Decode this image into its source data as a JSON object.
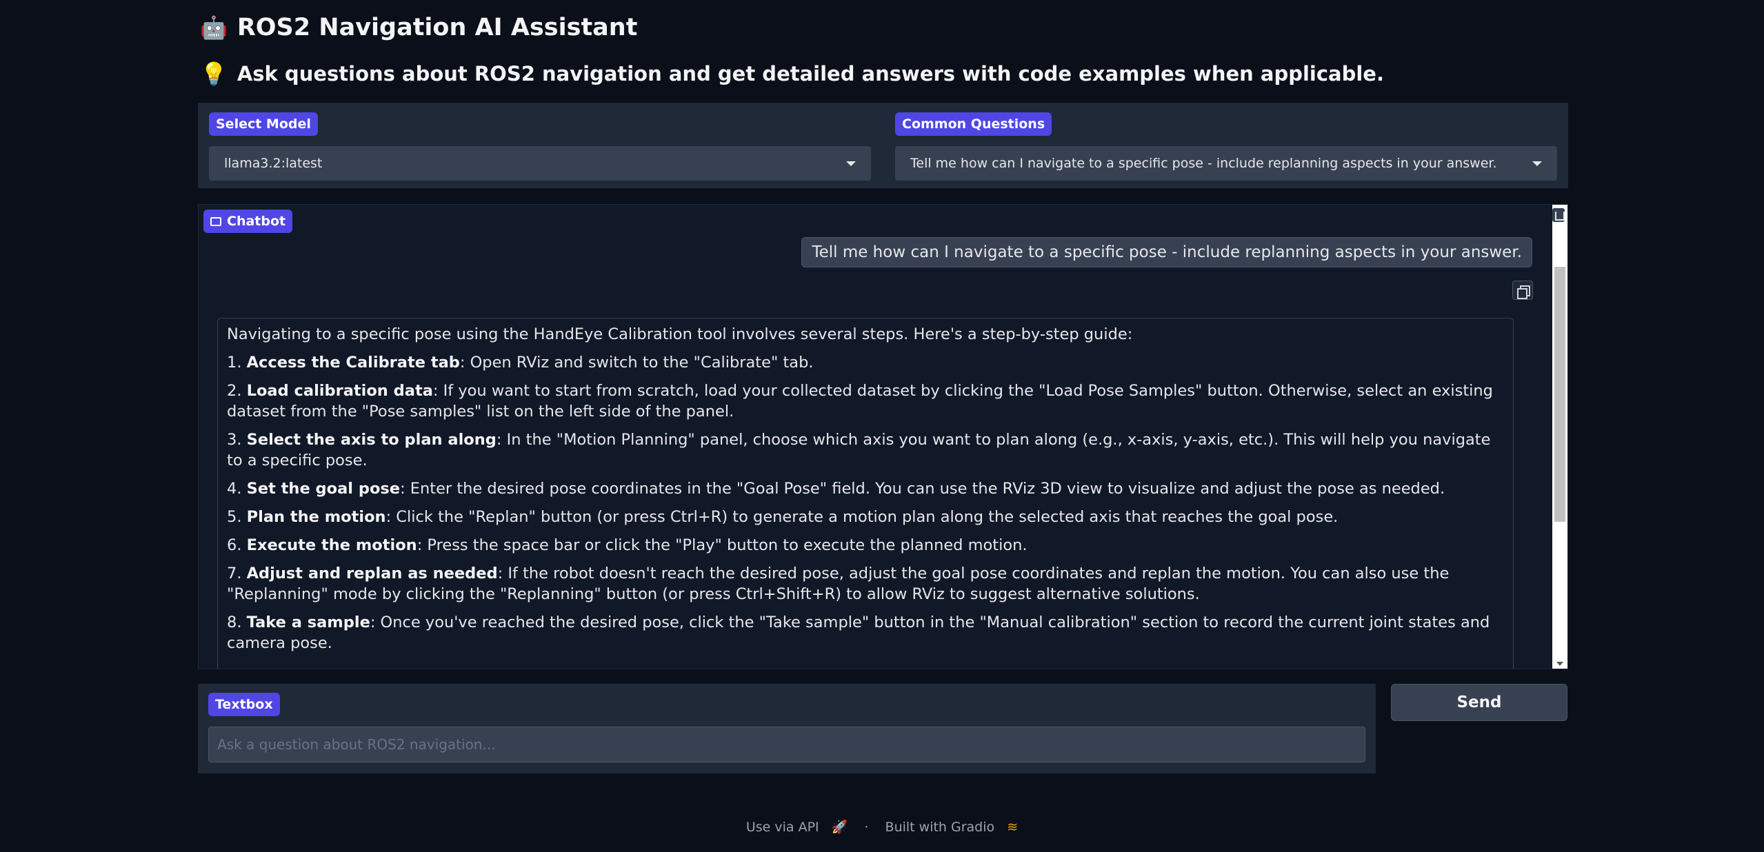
{
  "header": {
    "icon": "🤖",
    "title": "ROS2 Navigation AI Assistant",
    "subtitle_icon": "💡",
    "subtitle": "Ask questions about ROS2 navigation and get detailed answers with code examples when applicable."
  },
  "model_select": {
    "label": "Select Model",
    "value": "llama3.2:latest"
  },
  "common_questions": {
    "label": "Common Questions",
    "value": "Tell me how can I navigate to a specific pose - include replanning aspects in your answer."
  },
  "chatbot": {
    "label": "Chatbot",
    "user_message": "Tell me how can I navigate to a specific pose - include replanning aspects in your answer.",
    "intro": "Navigating to a specific pose using the HandEye Calibration tool involves several steps. Here's a step-by-step guide:",
    "steps": [
      {
        "num": "1.",
        "title": "Access the Calibrate tab",
        "text": ": Open RViz and switch to the \"Calibrate\" tab."
      },
      {
        "num": "2.",
        "title": "Load calibration data",
        "text": ": If you want to start from scratch, load your collected dataset by clicking the \"Load Pose Samples\" button. Otherwise, select an existing dataset from the \"Pose samples\" list on the left side of the panel."
      },
      {
        "num": "3.",
        "title": "Select the axis to plan along",
        "text": ": In the \"Motion Planning\" panel, choose which axis you want to plan along (e.g., x-axis, y-axis, etc.). This will help you navigate to a specific pose."
      },
      {
        "num": "4.",
        "title": "Set the goal pose",
        "text": ": Enter the desired pose coordinates in the \"Goal Pose\" field. You can use the RViz 3D view to visualize and adjust the pose as needed."
      },
      {
        "num": "5.",
        "title": "Plan the motion",
        "text": ": Click the \"Replan\" button (or press Ctrl+R) to generate a motion plan along the selected axis that reaches the goal pose."
      },
      {
        "num": "6.",
        "title": "Execute the motion",
        "text": ": Press the space bar or click the \"Play\" button to execute the planned motion."
      },
      {
        "num": "7.",
        "title": "Adjust and replan as needed",
        "text": ": If the robot doesn't reach the desired pose, adjust the goal pose coordinates and replan the motion. You can also use the \"Replanning\" mode by clicking the \"Replanning\" button (or press Ctrl+Shift+R) to allow RViz to suggest alternative solutions."
      },
      {
        "num": "8.",
        "title": "Take a sample",
        "text": ": Once you've reached the desired pose, click the \"Take sample\" button in the \"Manual calibration\" section to record the current joint states and camera pose."
      }
    ]
  },
  "textbox": {
    "label": "Textbox",
    "placeholder": "Ask a question about ROS2 navigation..."
  },
  "send_button": {
    "label": "Send"
  },
  "footer": {
    "api_link": "Use via API",
    "separator": "·",
    "built_with": "Built with Gradio"
  }
}
